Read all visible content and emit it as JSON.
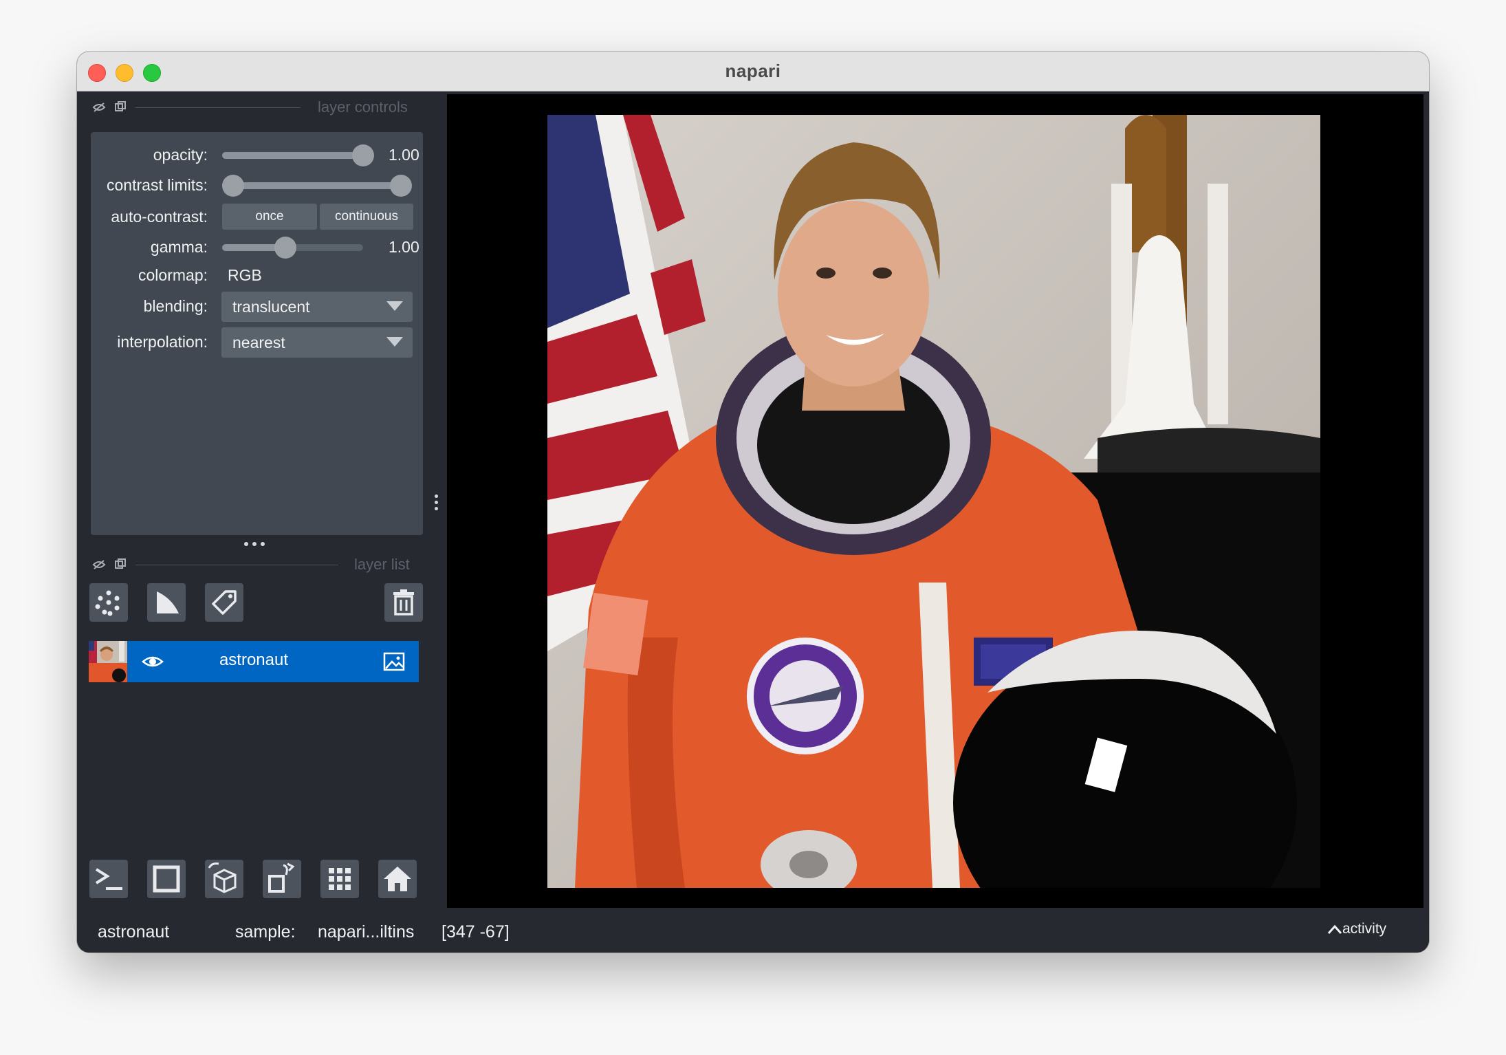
{
  "window": {
    "title": "napari"
  },
  "layer_controls": {
    "header": "layer controls",
    "opacity": {
      "label": "opacity:",
      "value": "1.00",
      "fraction": 1.0
    },
    "contrast_limits": {
      "label": "contrast limits:",
      "low": 0.0,
      "high": 1.0
    },
    "auto_contrast": {
      "label": "auto-contrast:",
      "once": "once",
      "continuous": "continuous"
    },
    "gamma": {
      "label": "gamma:",
      "value": "1.00",
      "fraction": 0.45
    },
    "colormap": {
      "label": "colormap:",
      "value": "RGB"
    },
    "blending": {
      "label": "blending:",
      "value": "translucent"
    },
    "interpolation": {
      "label": "interpolation:",
      "value": "nearest"
    }
  },
  "layer_list": {
    "header": "layer list",
    "layers": [
      {
        "name": "astronaut",
        "visible": true,
        "type": "image"
      }
    ]
  },
  "status": {
    "layer": "astronaut",
    "source_label": "sample:",
    "source_value": "napari...iltins",
    "coords": "[347 -67]",
    "activity": "activity"
  },
  "colors": {
    "selected_layer": "#0066c4",
    "panel": "#414851",
    "background": "#262930"
  }
}
